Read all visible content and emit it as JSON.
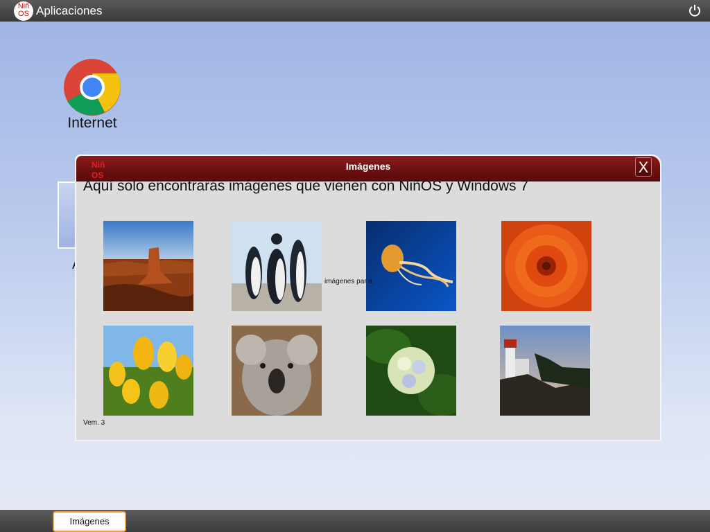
{
  "topbar": {
    "logo_line1": "Niñ",
    "logo_line2": "OS",
    "title": "Aplicaciones",
    "power_icon": "power-icon"
  },
  "desktop": {
    "internet_label": "Internet",
    "hidden_letter": "A"
  },
  "window": {
    "title": "Imágenes",
    "logo_line1": "Niñ",
    "logo_line2": "OS",
    "close_label": "X",
    "headline": "Aquí solo encontrarás imágenes que vienen con NiñOS y Windows 7",
    "stray_text": "imágenes par                              a",
    "version": "Vem. 3",
    "thumbnails": [
      "desert-rock",
      "penguins",
      "jellyfish",
      "chrysanthemum",
      "tulips",
      "koala",
      "hydrangeas",
      "lighthouse"
    ]
  },
  "taskbar": {
    "active_task": "Imágenes"
  },
  "colors": {
    "titlebar": "#6a0f10",
    "accent": "#f0a040",
    "window_bg": "#dcdcdc"
  }
}
